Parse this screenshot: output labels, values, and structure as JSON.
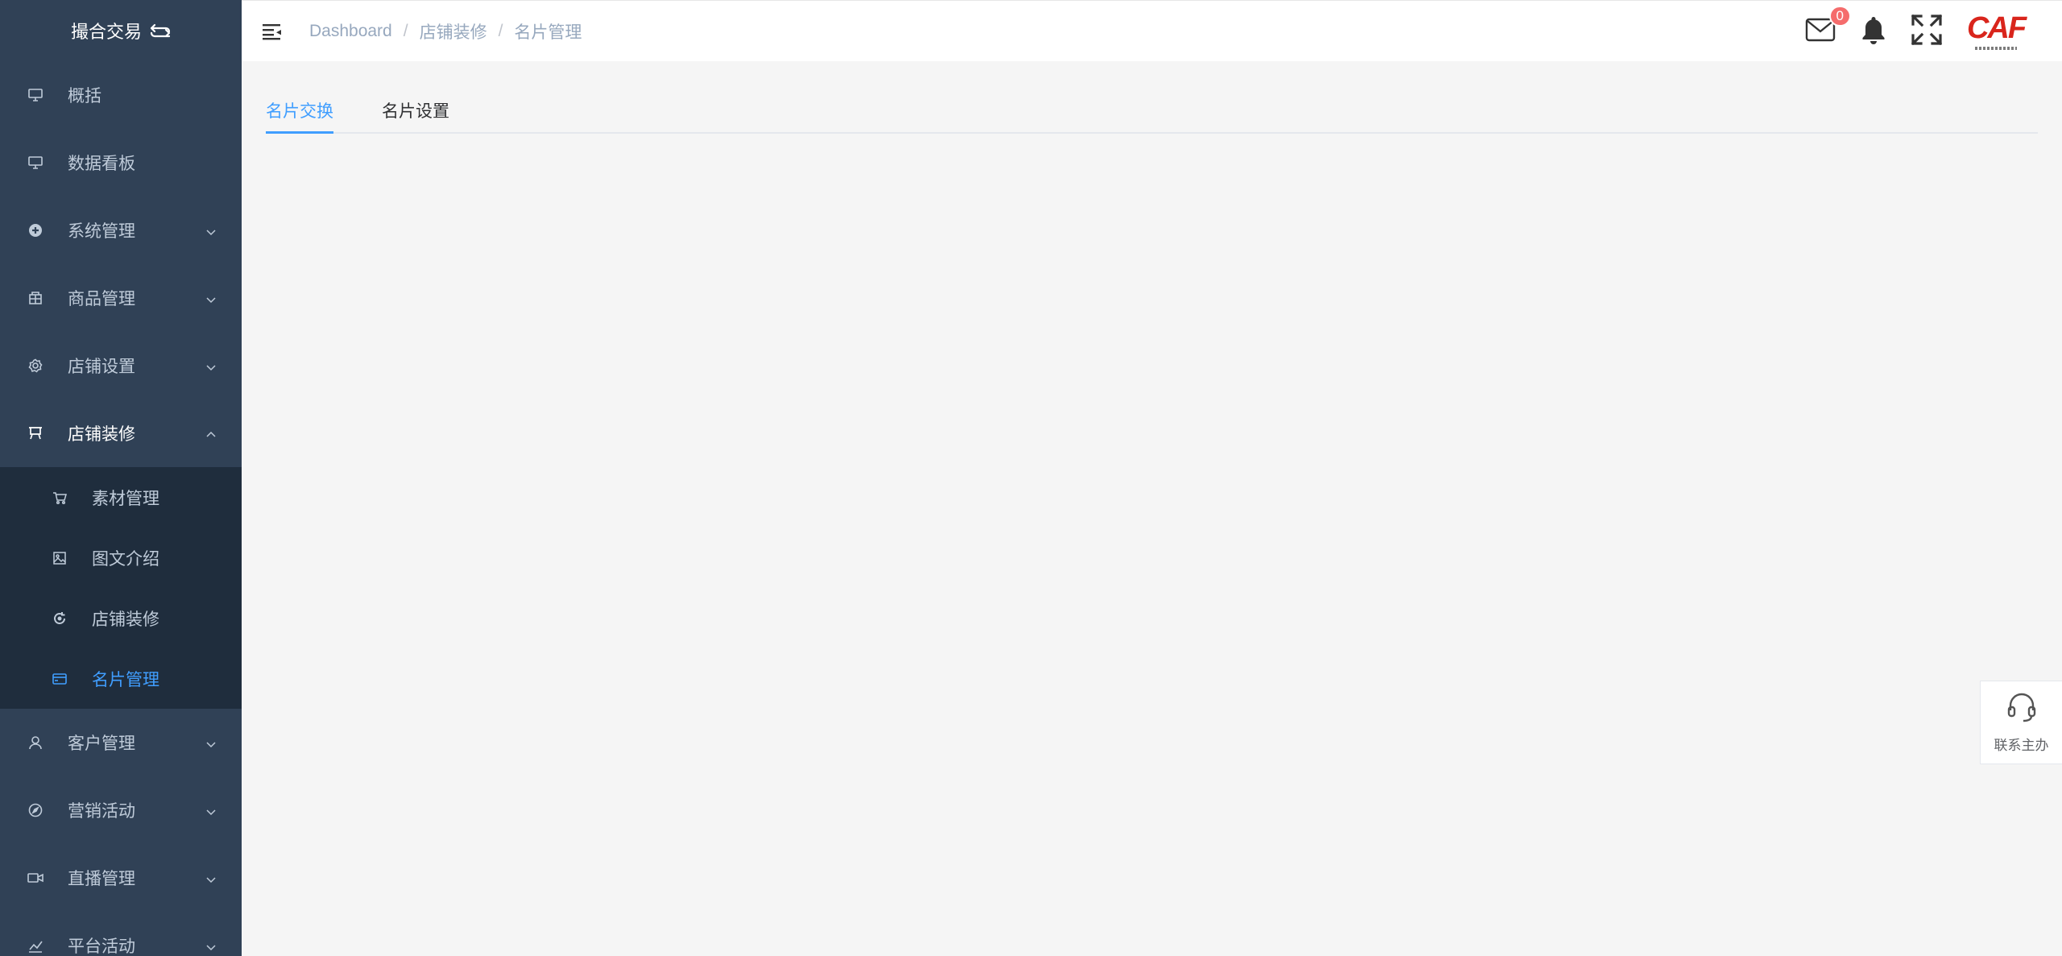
{
  "sidebar": {
    "brand": "撮合交易",
    "items": [
      {
        "label": "概括",
        "icon": "monitor-icon",
        "has_arrow": false
      },
      {
        "label": "数据看板",
        "icon": "monitor-icon",
        "has_arrow": false
      },
      {
        "label": "系统管理",
        "icon": "settings-icon",
        "has_arrow": true
      },
      {
        "label": "商品管理",
        "icon": "building-icon",
        "has_arrow": true
      },
      {
        "label": "店铺设置",
        "icon": "gear-icon",
        "has_arrow": true
      },
      {
        "label": "店铺装修",
        "icon": "easel-icon",
        "has_arrow": true,
        "open": true
      }
    ],
    "submenu": [
      {
        "label": "素材管理",
        "icon": "cart-icon"
      },
      {
        "label": "图文介绍",
        "icon": "image-icon"
      },
      {
        "label": "店铺装修",
        "icon": "refresh-icon"
      },
      {
        "label": "名片管理",
        "icon": "card-icon",
        "active": true
      }
    ],
    "items_after": [
      {
        "label": "客户管理",
        "icon": "user-icon"
      },
      {
        "label": "营销活动",
        "icon": "compass-icon"
      },
      {
        "label": "直播管理",
        "icon": "video-icon"
      },
      {
        "label": "平台活动",
        "icon": "chart-icon"
      }
    ]
  },
  "header": {
    "breadcrumb": [
      "Dashboard",
      "店铺装修",
      "名片管理"
    ],
    "mail_count": "0",
    "logo_text": "CAF"
  },
  "main": {
    "tabs": [
      {
        "label": "名片交换",
        "active": true
      },
      {
        "label": "名片设置",
        "active": false
      }
    ]
  },
  "service": {
    "label": "联系主办"
  },
  "colors": {
    "sidebar_bg": "#304156",
    "submenu_bg": "#1f2d3d",
    "accent": "#409eff",
    "badge": "#f56c6c"
  }
}
